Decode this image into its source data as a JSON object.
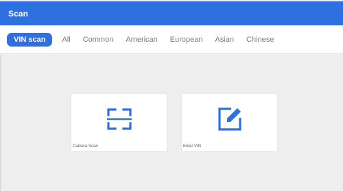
{
  "window": {
    "title": "Scan"
  },
  "tabs": [
    {
      "label": "VIN scan",
      "active": true
    },
    {
      "label": "All",
      "active": false
    },
    {
      "label": "Common",
      "active": false
    },
    {
      "label": "American",
      "active": false
    },
    {
      "label": "European",
      "active": false
    },
    {
      "label": "Asian",
      "active": false
    },
    {
      "label": "Chinese",
      "active": false
    }
  ],
  "cards": [
    {
      "label": "Camera Scan",
      "icon": "scan-frame-icon"
    },
    {
      "label": "Enter VIN",
      "icon": "edit-icon"
    }
  ],
  "colors": {
    "accent": "#2f6fe0",
    "background": "#eeeeee"
  }
}
